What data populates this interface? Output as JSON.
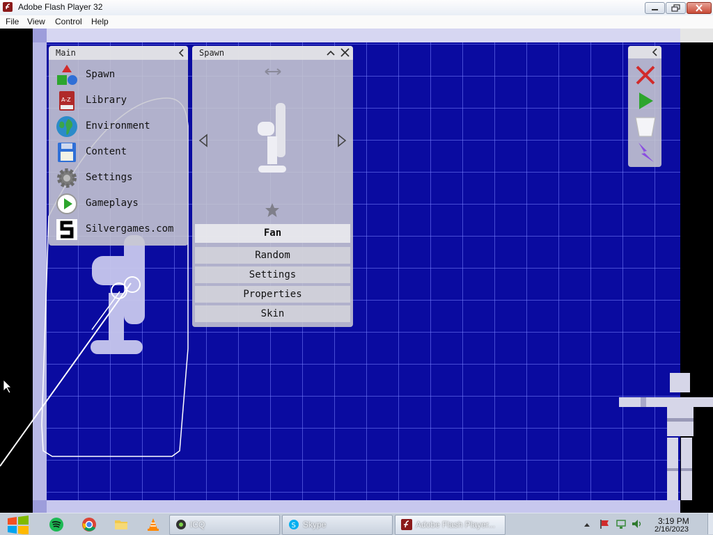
{
  "window": {
    "title": "Adobe Flash Player 32"
  },
  "menu": {
    "items": [
      "File",
      "View",
      "Control",
      "Help"
    ]
  },
  "main_panel": {
    "title": "Main",
    "items": [
      {
        "label": "Spawn",
        "icon": "spawn-shapes-icon"
      },
      {
        "label": "Library",
        "icon": "library-book-icon"
      },
      {
        "label": "Environment",
        "icon": "globe-icon"
      },
      {
        "label": "Content",
        "icon": "floppy-disk-icon"
      },
      {
        "label": "Settings",
        "icon": "gear-icon"
      },
      {
        "label": "Gameplays",
        "icon": "play-circle-icon"
      },
      {
        "label": "Silvergames.com",
        "icon": "silvergames-logo-icon"
      }
    ]
  },
  "spawn_panel": {
    "title": "Spawn",
    "selected_item": "Fan",
    "options": [
      "Random",
      "Settings",
      "Properties",
      "Skin"
    ]
  },
  "tools_panel": {
    "icons": [
      "delete-x-icon",
      "play-icon",
      "bucket-icon",
      "lightning-icon"
    ]
  },
  "taskbar": {
    "tasks": [
      {
        "label": "ICQ",
        "icon": "icq-icon"
      },
      {
        "label": "Skype",
        "icon": "skype-icon"
      },
      {
        "label": "Adobe Flash Player...",
        "icon": "flash-icon"
      }
    ],
    "pinned": [
      "spotify-icon",
      "chrome-icon",
      "folder-icon",
      "vlc-icon"
    ],
    "time": "3:19 PM",
    "date": "2/16/2023"
  },
  "colors": {
    "grid_background": "#0a0ba0",
    "panel": "#c8c8d2",
    "accent_red": "#d12b2b",
    "accent_green": "#2da52d",
    "accent_purple": "#8a4ee0"
  }
}
